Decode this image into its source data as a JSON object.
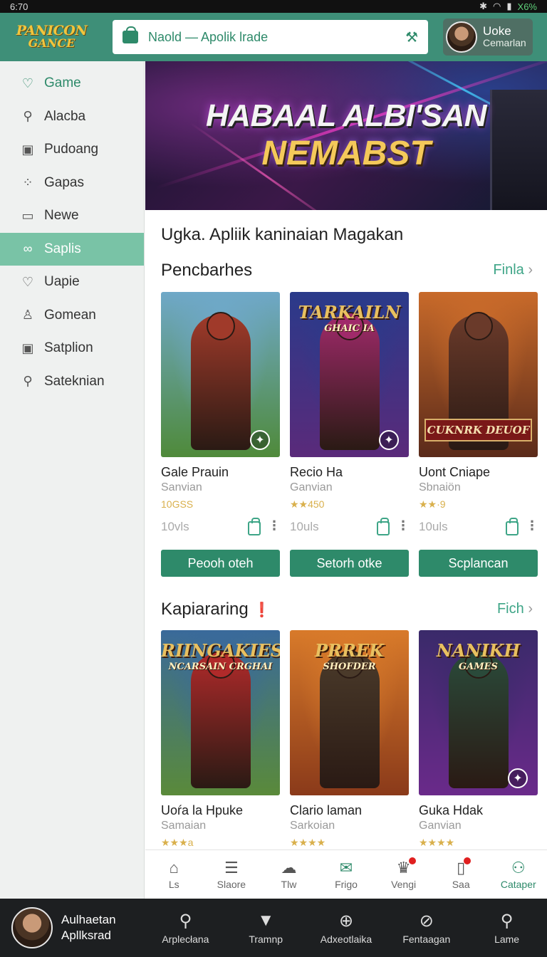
{
  "status": {
    "time": "6:70",
    "battery": "X6%"
  },
  "header": {
    "logo_line1": "PANICON",
    "logo_line2": "GANCE",
    "search_text": "Naold — Apolik lrade",
    "user_name": "Uoke",
    "user_sub": "Cemarlan"
  },
  "sidebar": {
    "items": [
      {
        "label": "Game",
        "icon": "heart-icon"
      },
      {
        "label": "Alacba",
        "icon": "key-icon"
      },
      {
        "label": "Pudoang",
        "icon": "image-icon"
      },
      {
        "label": "Gapas",
        "icon": "apps-icon"
      },
      {
        "label": "Newe",
        "icon": "calendar-icon"
      },
      {
        "label": "Saplis",
        "icon": "link-icon"
      },
      {
        "label": "Uapie",
        "icon": "heart-icon"
      },
      {
        "label": "Gomean",
        "icon": "user-icon"
      },
      {
        "label": "Satplion",
        "icon": "image-icon"
      },
      {
        "label": "Sateknian",
        "icon": "key-icon"
      }
    ],
    "active_index": 5
  },
  "banner": {
    "line1": "HABAAL ALBI'SAN",
    "line2": "NEMABST"
  },
  "main": {
    "heading": "Ugka. Apliik kaninaian Magakan",
    "section1": {
      "title": "Pencbarhes",
      "more": "Finla",
      "cards": [
        {
          "name": "Gale Prauin",
          "dev": "Sanvian",
          "rating": "10GSS",
          "size": "10vls",
          "button": "Peooh oteh",
          "colors": [
            "#6fa8c8",
            "#4f8a3a",
            "#a03a2a"
          ]
        },
        {
          "name": "Recio Ha",
          "dev": "Ganvian",
          "rating": "★★450",
          "size": "10uls",
          "button": "Setorh otke",
          "logo": "TARKAILN",
          "logo_sub": "GHAIC IA",
          "colors": [
            "#2a3a8a",
            "#5a2a7a",
            "#a02a6a"
          ]
        },
        {
          "name": "Uont Cniape",
          "dev": "Sbnaiön",
          "rating": "★★·9",
          "size": "10uls",
          "button": "Scplancan",
          "ribbon": "CUKNRK DEUOF",
          "colors": [
            "#c86a2a",
            "#5a2a1a",
            "#6a3a2a"
          ]
        }
      ]
    },
    "section2": {
      "title": "Kapiararing",
      "more": "Fich",
      "cards": [
        {
          "name": "Uoŕa la Hpuke",
          "dev": "Samaian",
          "rating": "★★★a",
          "logo": "RIINGAKIESH",
          "logo_sub": "NCARSAIN CRGHAI",
          "colors": [
            "#3a6a9a",
            "#5a8a3a",
            "#b02a2a"
          ]
        },
        {
          "name": "Clario laman",
          "dev": "Sarkoian",
          "rating": "★★★★",
          "logo": "PRREK",
          "logo_sub": "SHOFDER",
          "colors": [
            "#d87a2a",
            "#8a3a1a",
            "#4a3a2a"
          ]
        },
        {
          "name": "Guka Hdak",
          "dev": "Ganvian",
          "rating": "★★★★",
          "logo": "NANIKH",
          "logo_sub": "GAMES",
          "colors": [
            "#3a2a6a",
            "#6a2a8a",
            "#2a4a3a"
          ]
        }
      ]
    }
  },
  "inner_nav": [
    {
      "label": "Ls",
      "icon": "home-icon"
    },
    {
      "label": "Slaore",
      "icon": "document-icon"
    },
    {
      "label": "Tlw",
      "icon": "chat-icon"
    },
    {
      "label": "Frigo",
      "icon": "mail-icon"
    },
    {
      "label": "Vengi",
      "icon": "trophy-icon"
    },
    {
      "label": "Saa",
      "icon": "bookmark-icon"
    },
    {
      "label": "Cataper",
      "icon": "group-icon"
    }
  ],
  "bottom_bar": {
    "profile_line1": "Aulhaetan",
    "profile_line2": "Apllksrad",
    "items": [
      {
        "label": "Arplecłana",
        "icon": "search-icon"
      },
      {
        "label": "Tramnp",
        "icon": "download-icon"
      },
      {
        "label": "Adxeotlaika",
        "icon": "globe-icon"
      },
      {
        "label": "Fentaagan",
        "icon": "compass-icon"
      },
      {
        "label": "Lame",
        "icon": "search-icon"
      }
    ]
  }
}
